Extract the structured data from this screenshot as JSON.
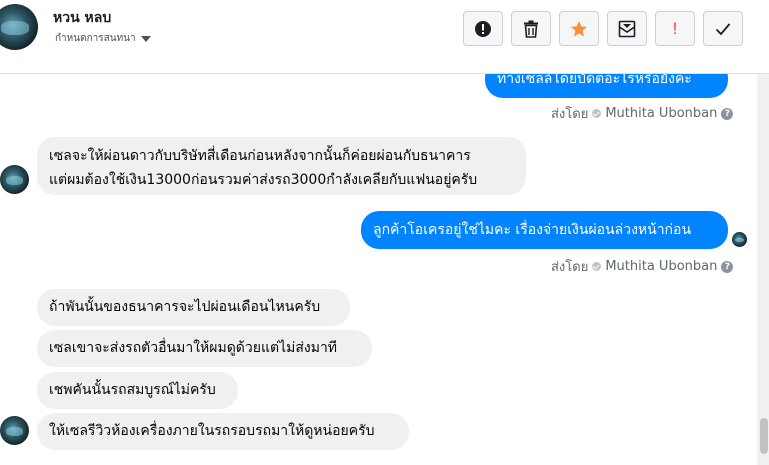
{
  "header": {
    "name": "หวน หลบ",
    "subtitle": "กำหนดการสนทนา",
    "actions": [
      {
        "name": "alert-icon"
      },
      {
        "name": "trash-icon"
      },
      {
        "name": "star-icon",
        "color": "#f7923b"
      },
      {
        "name": "archive-mail-icon"
      },
      {
        "name": "important-icon",
        "text": "!",
        "color": "#fa3e3e"
      },
      {
        "name": "checkmark-icon"
      }
    ]
  },
  "messages": {
    "m1": "ทางเซลล์โดยบัดตอะไรหรือยังคะ",
    "sent1": {
      "label": "ส่งโดย",
      "author": "Muthita Ubonban"
    },
    "m2_line1": "เซลจะให้ผ่อนดาวกับบริษัทสี่เดือนก่อนหลังจากนั้นก็ค่อยผ่อนกับธนาคาร",
    "m2_line2": "แต่ผมต้องใช้เงิน13000ก่อนรวมค่าส่งรถ3000กำลังเคลียกับแฟนอยู่ครับ",
    "m3": "ลูกค้าโอเครอยู่ใช่ไมคะ เรื่องจ่ายเงินผ่อนล่วงหน้าก่อน",
    "sent2": {
      "label": "ส่งโดย",
      "author": "Muthita Ubonban"
    },
    "m4": "ถ้าพันนั้นของธนาคารจะไปผ่อนเดือนไหนครับ",
    "m5": "เซลเขาจะส่งรถตัวอื่นมาให้ผมดูด้วยแต่ไม่ส่งมาที",
    "m6": "เชพคันนั้นรถสมบูรณ์ไม่ครับ",
    "m7": "ให้เซลรีวิวห้องเครื่องภายในรถรอบรถมาให้ดูหน่อยครับ"
  },
  "colors": {
    "outgoing_bubble": "#0084ff",
    "incoming_bubble": "#f1f0f0",
    "meta_text": "#606770"
  }
}
